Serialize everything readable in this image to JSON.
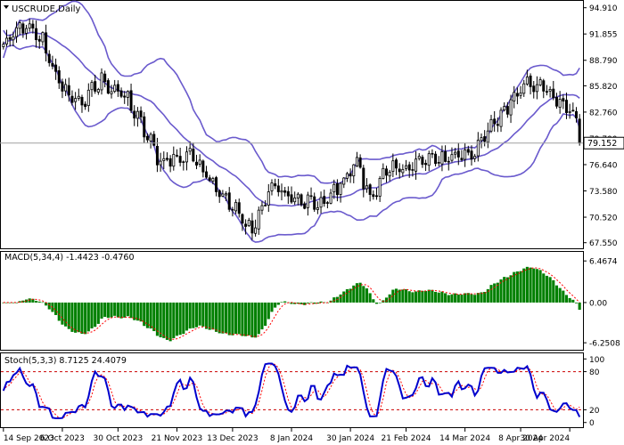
{
  "chart_data": [
    {
      "type": "candlestick",
      "panel": "price",
      "title": "USCRUDE,Daily",
      "last_price": "79.152",
      "ylim": [
        67.0,
        95.5
      ],
      "y_ticks": [
        "94.910",
        "91.855",
        "88.790",
        "85.820",
        "82.760",
        "79.700",
        "76.640",
        "73.580",
        "70.520",
        "67.550"
      ],
      "x_ticks": [
        "14 Sep 2023",
        "6 Oct 2023",
        "30 Oct 2023",
        "21 Nov 2023",
        "13 Dec 2023",
        "8 Jan 2024",
        "30 Jan 2024",
        "21 Feb 2024",
        "14 Mar 2024",
        "8 Apr 2024",
        "30 Apr 2024"
      ],
      "close_anchors": [
        [
          0,
          90.5
        ],
        [
          6,
          92.8
        ],
        [
          12,
          91.0
        ],
        [
          18,
          85.3
        ],
        [
          24,
          83.8
        ],
        [
          30,
          86.5
        ],
        [
          38,
          84.2
        ],
        [
          48,
          77.0
        ],
        [
          58,
          77.8
        ],
        [
          68,
          72.5
        ],
        [
          76,
          69.0
        ],
        [
          82,
          74.2
        ],
        [
          90,
          72.3
        ],
        [
          98,
          72.0
        ],
        [
          108,
          77.0
        ],
        [
          112,
          72.6
        ],
        [
          116,
          75.5
        ],
        [
          128,
          77.0
        ],
        [
          136,
          77.5
        ],
        [
          144,
          78.2
        ],
        [
          152,
          82.5
        ],
        [
          160,
          86.6
        ],
        [
          166,
          85.3
        ],
        [
          170,
          83.8
        ],
        [
          174,
          82.8
        ],
        [
          176,
          79.152
        ]
      ],
      "series": [
        {
          "name": "close",
          "values": []
        },
        {
          "name": "bb_mid",
          "values": []
        },
        {
          "name": "bb_upper",
          "values": []
        },
        {
          "name": "bb_lower",
          "values": []
        }
      ],
      "colors": {
        "candle": "#000000",
        "bollinger": "#6a5acd",
        "last_price_line": "#a0a0a0"
      }
    },
    {
      "type": "bar",
      "panel": "macd",
      "title": "MACD(5,34,4) -1.4423 -0.4760",
      "ylim": [
        -7.2,
        7.6
      ],
      "y_ticks": [
        "6.4674",
        "0.00",
        "-6.2508"
      ],
      "series": [
        {
          "name": "histogram",
          "values": []
        },
        {
          "name": "signal",
          "values": []
        }
      ],
      "colors": {
        "histogram": "#008000",
        "signal": "#ff0000"
      }
    },
    {
      "type": "line",
      "panel": "stoch",
      "title": "Stoch(5,3,3) 8.7125 24.4079",
      "ylim": [
        -6,
        106
      ],
      "y_ticks": [
        "100",
        "80",
        "20",
        "0"
      ],
      "levels": [
        80,
        20
      ],
      "series": [
        {
          "name": "%K",
          "values": []
        },
        {
          "name": "%D",
          "values": []
        }
      ],
      "colors": {
        "k_line": "#0000cd",
        "d_line": "#ff0000",
        "levels": "#cc0000"
      }
    }
  ]
}
